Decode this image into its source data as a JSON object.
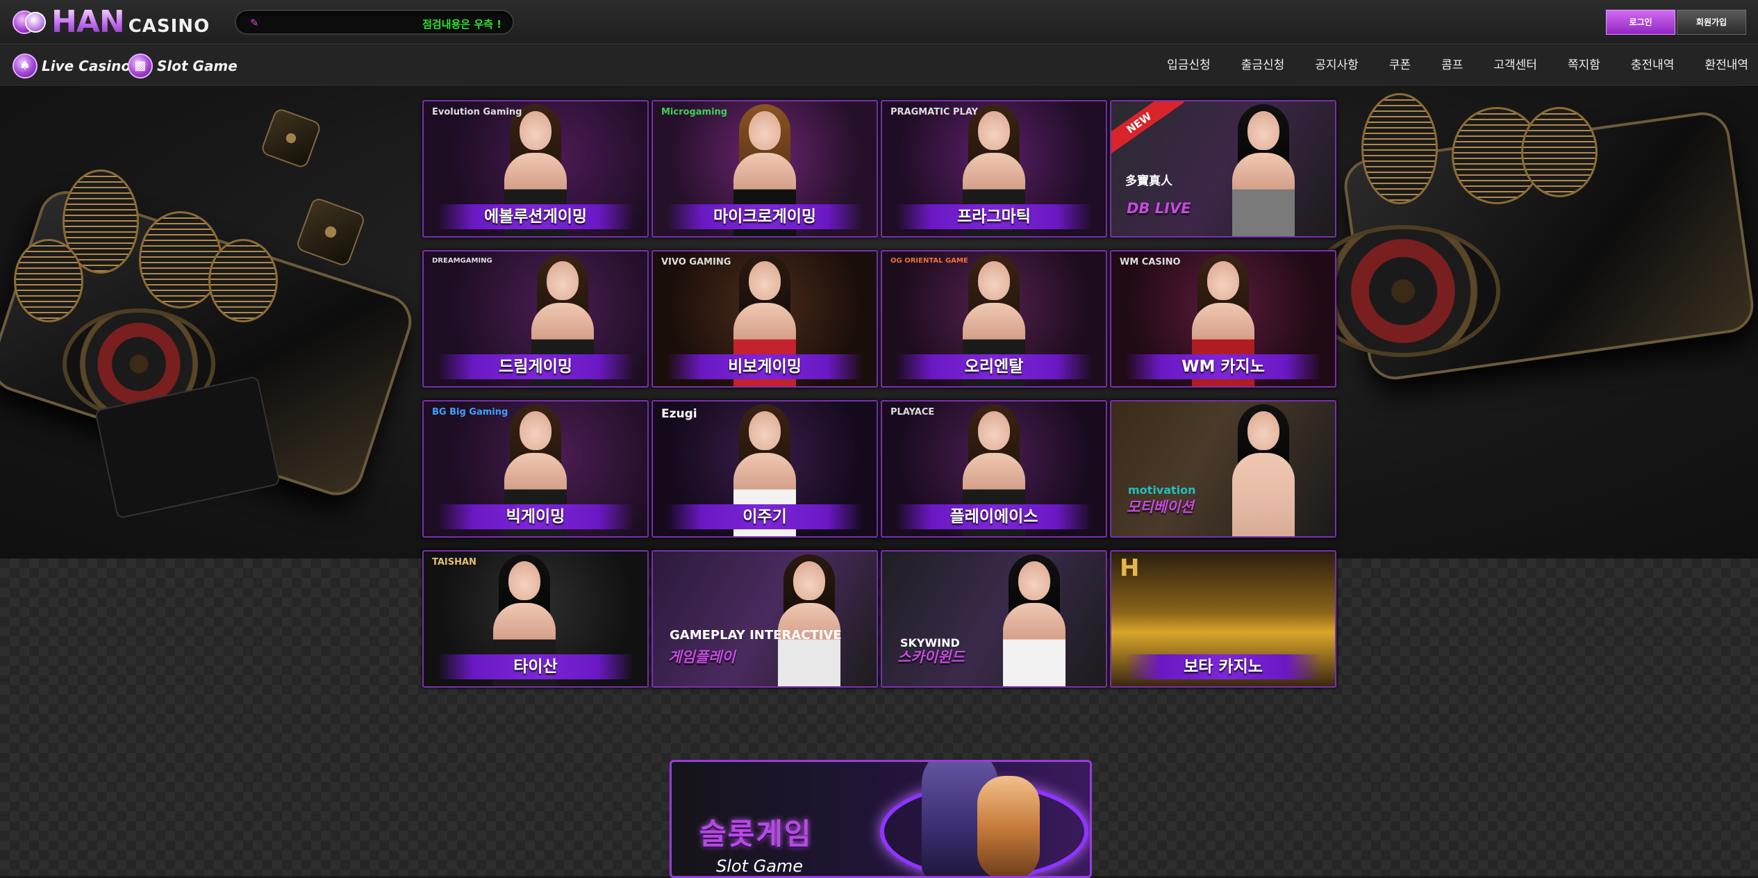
{
  "header": {
    "logo_main": "HAN",
    "logo_sub": "CASINO",
    "ticker_text": "점검내용은 우측 !",
    "login_label": "로그인",
    "join_label": "회원가입"
  },
  "nav": {
    "tabs": [
      {
        "label": "Live Casino",
        "icon": "spade-coin-icon"
      },
      {
        "label": "Slot Game",
        "icon": "slot-machine-coin-icon"
      }
    ],
    "menu": [
      "입금신청",
      "출금신청",
      "공지사항",
      "쿠폰",
      "콤프",
      "고객센터",
      "쪽지함",
      "충전내역",
      "환전내역"
    ]
  },
  "games": [
    {
      "label": "에볼루션게이밍",
      "brand": "Evolution Gaming"
    },
    {
      "label": "마이크로게이밍",
      "brand": "Microgaming"
    },
    {
      "label": "프라그마틱",
      "brand": "PRAGMATIC PLAY"
    },
    {
      "label": "DB LIVE",
      "brand": "多寶真人",
      "badge": "NEW"
    },
    {
      "label": "드림게이밍",
      "brand": "DREAMGAMING"
    },
    {
      "label": "비보게이밍",
      "brand": "VIVO GAMING"
    },
    {
      "label": "오리엔탈",
      "brand": "OG ORIENTAL GAME"
    },
    {
      "label": "WM 카지노",
      "brand": "WM CASINO"
    },
    {
      "label": "빅게이밍",
      "brand": "BG Big Gaming"
    },
    {
      "label": "이주기",
      "brand": "Ezugi"
    },
    {
      "label": "플레이에이스",
      "brand": "PLAYACE"
    },
    {
      "label": "모티베이션",
      "brand": "motivation"
    },
    {
      "label": "타이산",
      "brand": "TAISHAN"
    },
    {
      "label": "게임플레이",
      "brand": "GAMEPLAY INTERACTIVE"
    },
    {
      "label": "스카이윈드",
      "brand": "SKYWIND"
    },
    {
      "label": "보타 카지노",
      "brand": "H"
    }
  ],
  "slot_banner": {
    "title": "슬롯게임",
    "subtitle": "Slot Game"
  },
  "colors": {
    "accent": "#9b3be0",
    "label_bar": "#7d26d8",
    "ticker_text": "#2ee02e",
    "new_ribbon": "#d8242a"
  }
}
